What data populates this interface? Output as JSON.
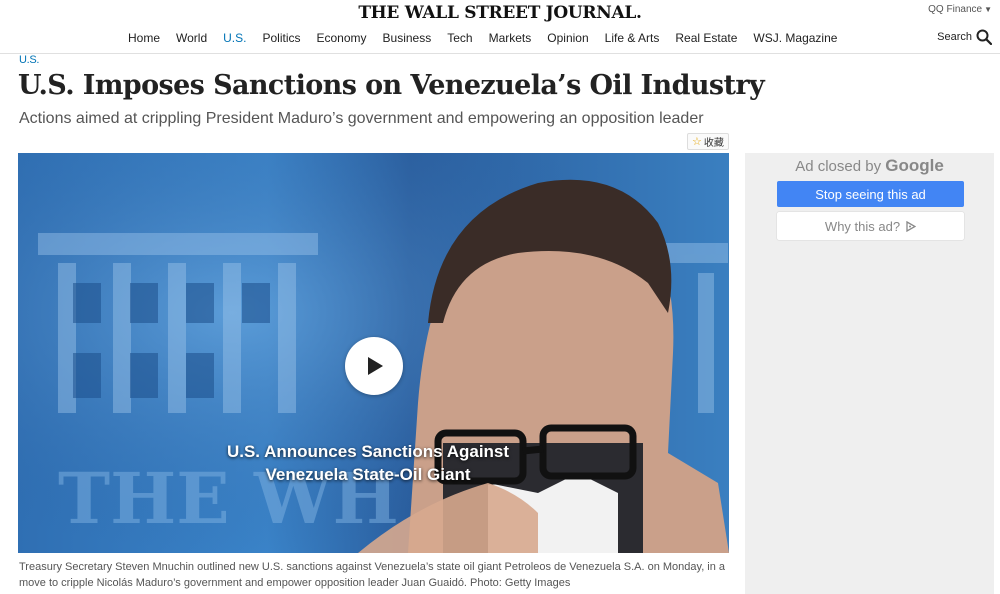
{
  "masthead": {
    "logo": "THE WALL STREET JOURNAL.",
    "edition": "QQ Finance",
    "search_label": "Search"
  },
  "nav": [
    {
      "label": "Home",
      "active": false
    },
    {
      "label": "World",
      "active": false
    },
    {
      "label": "U.S.",
      "active": true
    },
    {
      "label": "Politics",
      "active": false
    },
    {
      "label": "Economy",
      "active": false
    },
    {
      "label": "Business",
      "active": false
    },
    {
      "label": "Tech",
      "active": false
    },
    {
      "label": "Markets",
      "active": false
    },
    {
      "label": "Opinion",
      "active": false
    },
    {
      "label": "Life & Arts",
      "active": false
    },
    {
      "label": "Real Estate",
      "active": false
    },
    {
      "label": "WSJ. Magazine",
      "active": false
    }
  ],
  "article": {
    "section": "U.S.",
    "headline": "U.S. Imposes Sanctions on Venezuela’s Oil Industry",
    "dek": "Actions aimed at crippling President Maduro’s government and empowering an opposition leader",
    "favorite_label": "收藏",
    "video": {
      "title_line1": "U.S. Announces Sanctions Against",
      "title_line2": "Venezuela State-Oil Giant",
      "background_word": "THE WH"
    },
    "caption": "Treasury Secretary Steven Mnuchin outlined new U.S. sanctions against Venezuela’s state oil giant Petroleos de Venezuela S.A. on Monday, in a move to cripple Nicolás Maduro’s government and empower opposition leader Juan Guaidó. Photo: Getty Images"
  },
  "ad": {
    "closed_prefix": "Ad closed by",
    "closed_brand": "Google",
    "stop_label": "Stop seeing this ad",
    "why_label": "Why this ad?"
  },
  "colors": {
    "accent": "#0274b6",
    "ad_button": "#4285f4",
    "ad_bg": "#efefef"
  }
}
